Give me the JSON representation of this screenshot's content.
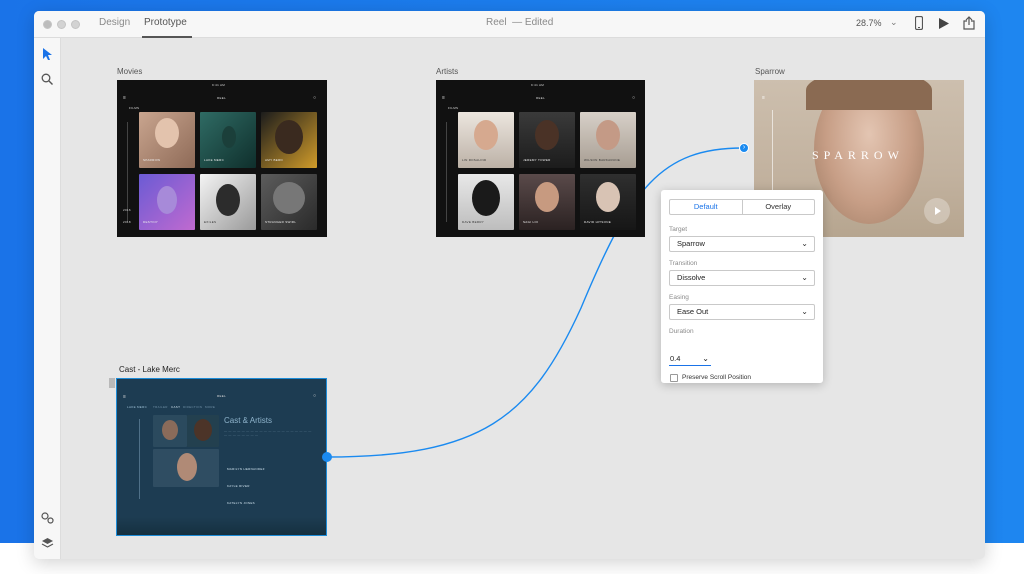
{
  "window": {
    "tabs": [
      "Design",
      "Prototype"
    ],
    "active_tab": "Prototype",
    "doc_name": "Reel",
    "doc_status": "— Edited",
    "zoom": "28.7%"
  },
  "artboards": {
    "movies": {
      "label": "Movies",
      "app_name": "REEL",
      "tabs": [
        "FILMS"
      ],
      "tiles": [
        "SPARROW",
        "LAKE MERC",
        "AMY BERD",
        "DESTINY",
        "EXILES",
        "STRANGER SWIRL"
      ],
      "years": [
        "2016",
        "2018"
      ]
    },
    "artists": {
      "label": "Artists",
      "app_name": "REEL",
      "tabs": [
        "FILMS"
      ],
      "tiles": [
        "LIN ROSALIND",
        "JEREMY TOWER",
        "WILSON BARKARUNE",
        "DAVE BERRY",
        "SAGI LOI",
        "DAVID HITSONE"
      ]
    },
    "sparrow": {
      "label": "Sparrow",
      "title": "SPARROW"
    },
    "cast": {
      "label": "Cast - Lake Merc",
      "app_name": "REEL",
      "heading": "Cast & Artists",
      "tabs": [
        "LAKE MERC",
        "TRAILER",
        "CAST",
        "DIRECTION",
        "MORE"
      ],
      "cast_list": [
        "MARILYN HERNANDEZ",
        "KAYLE RIVER",
        "KATELYN JONES"
      ]
    }
  },
  "panel": {
    "tabs": [
      "Default",
      "Overlay"
    ],
    "active_tab": "Default",
    "target_label": "Target",
    "target_value": "Sparrow",
    "transition_label": "Transition",
    "transition_value": "Dissolve",
    "easing_label": "Easing",
    "easing_value": "Ease Out",
    "duration_label": "Duration",
    "duration_value": "0.4",
    "preserve_label": "Preserve Scroll Position",
    "preserve_checked": false
  },
  "colors": {
    "accent": "#1a8af0",
    "background_band": "#1a73e8"
  }
}
